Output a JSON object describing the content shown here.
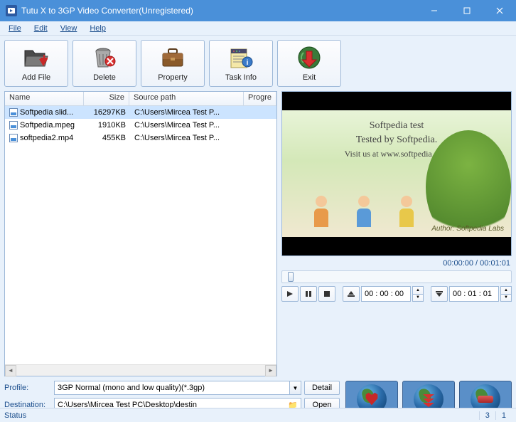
{
  "window": {
    "title": "Tutu X to 3GP Video Converter(Unregistered)"
  },
  "menu": {
    "file": "File",
    "edit": "Edit",
    "view": "View",
    "help": "Help"
  },
  "toolbar": {
    "add_file": "Add File",
    "delete": "Delete",
    "property": "Property",
    "task_info": "Task Info",
    "exit": "Exit"
  },
  "table": {
    "headers": {
      "name": "Name",
      "size": "Size",
      "path": "Source path",
      "progress": "Progre"
    },
    "rows": [
      {
        "name": "Softpedia slid...",
        "size": "16297KB",
        "path": "C:\\Users\\Mircea Test P...",
        "selected": true
      },
      {
        "name": "Softpedia.mpeg",
        "size": "1910KB",
        "path": "C:\\Users\\Mircea Test P...",
        "selected": false
      },
      {
        "name": "softpedia2.mp4",
        "size": "455KB",
        "path": "C:\\Users\\Mircea Test P...",
        "selected": false
      }
    ]
  },
  "preview": {
    "line1": "Softpedia test",
    "line2": "Tested by Softpedia.",
    "line3": "Visit us at www.softpedia.com",
    "author": "Author: Softpedia Labs"
  },
  "playback": {
    "time_display": "00:00:00 / 00:01:01",
    "start_time": "00 : 00 : 00",
    "end_time": "00 : 01 : 01"
  },
  "settings": {
    "profile_label": "Profile:",
    "profile_value": "3GP Normal (mono and low quality)(*.3gp)",
    "detail_btn": "Detail",
    "destination_label": "Destination:",
    "destination_value": "C:\\Users\\Mircea Test PC\\Desktop\\destin",
    "open_btn": "Open"
  },
  "statusbar": {
    "label": "Status",
    "cell1": "3",
    "cell2": "1"
  }
}
